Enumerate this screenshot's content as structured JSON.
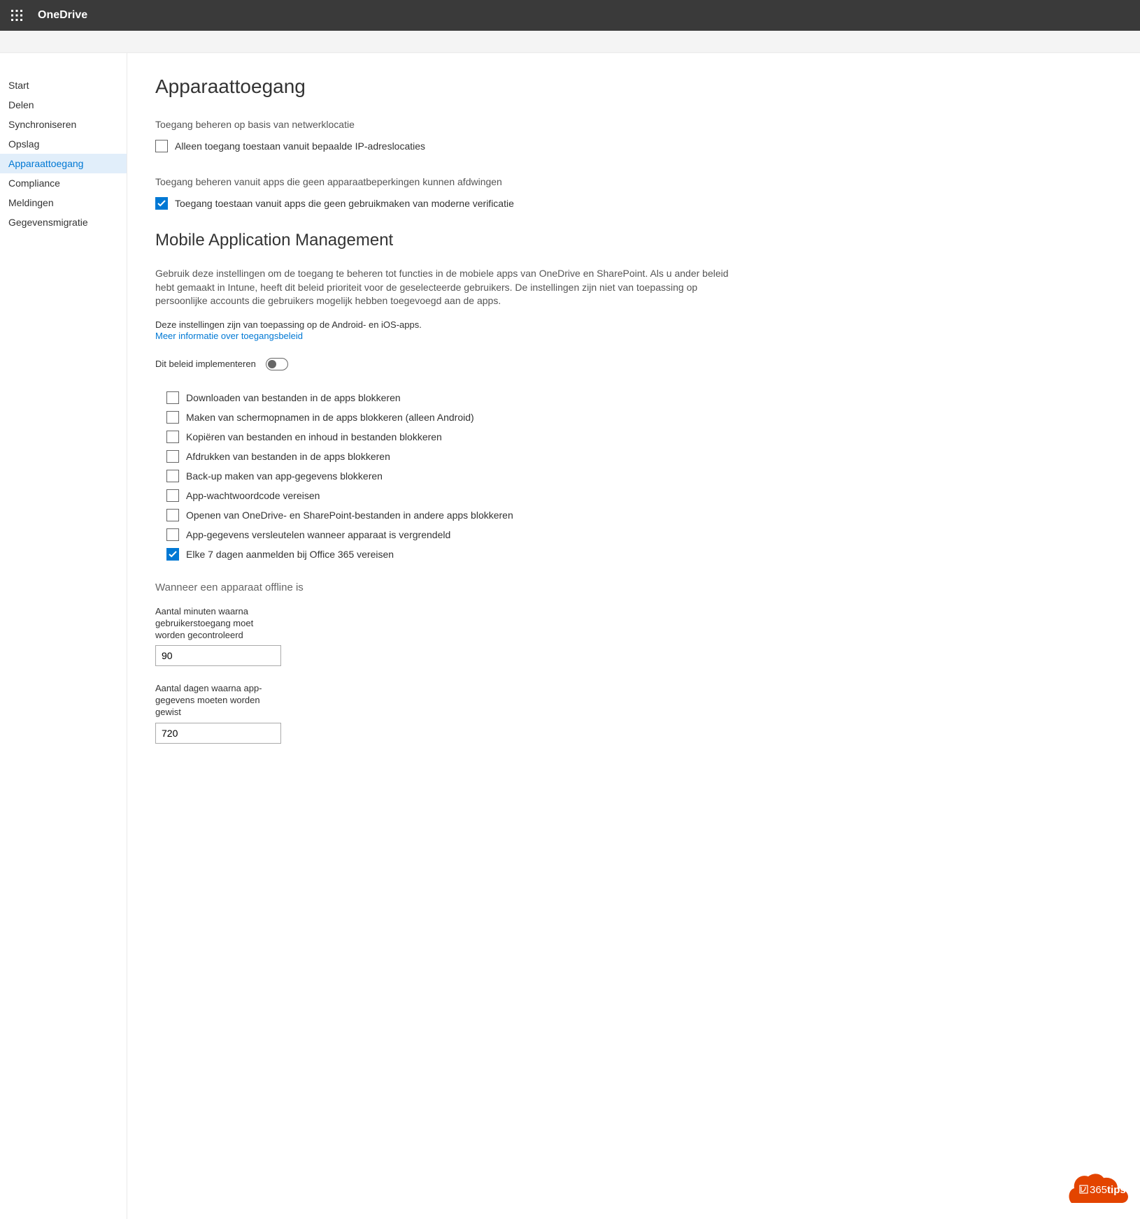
{
  "header": {
    "app_title": "OneDrive"
  },
  "sidebar": {
    "items": [
      {
        "label": "Start"
      },
      {
        "label": "Delen"
      },
      {
        "label": "Synchroniseren"
      },
      {
        "label": "Opslag"
      },
      {
        "label": "Apparaattoegang"
      },
      {
        "label": "Compliance"
      },
      {
        "label": "Meldingen"
      },
      {
        "label": "Gegevensmigratie"
      }
    ],
    "active_index": 4
  },
  "main": {
    "h1": "Apparaattoegang",
    "section1_sub": "Toegang beheren op basis van netwerklocatie",
    "cb_ip_label": "Alleen toegang toestaan vanuit bepaalde IP-adreslocaties",
    "section2_sub": "Toegang beheren vanuit apps die geen apparaatbeperkingen kunnen afdwingen",
    "cb_modern_auth_label": "Toegang toestaan vanuit apps die geen gebruikmaken van moderne verificatie",
    "h2": "Mobile Application Management",
    "mam_body": "Gebruik deze instellingen om de toegang te beheren tot functies in de mobiele apps van OneDrive en SharePoint. Als u ander beleid hebt gemaakt in Intune, heeft dit beleid prioriteit voor de geselecteerde gebruikers. De instellingen zijn niet van toepassing op persoonlijke accounts die gebruikers mogelijk hebben toegevoegd aan de apps.",
    "mam_note": "Deze instellingen zijn van toepassing op de Android- en iOS-apps.",
    "mam_link": "Meer informatie over toegangsbeleid",
    "toggle_label": "Dit beleid implementeren",
    "options": [
      {
        "label": "Downloaden van bestanden in de apps blokkeren",
        "checked": false
      },
      {
        "label": "Maken van schermopnamen in de apps blokkeren (alleen Android)",
        "checked": false
      },
      {
        "label": "Kopiëren van bestanden en inhoud in bestanden blokkeren",
        "checked": false
      },
      {
        "label": "Afdrukken van bestanden in de apps blokkeren",
        "checked": false
      },
      {
        "label": "Back-up maken van app-gegevens blokkeren",
        "checked": false
      },
      {
        "label": "App-wachtwoordcode vereisen",
        "checked": false
      },
      {
        "label": "Openen van OneDrive- en SharePoint-bestanden in andere apps blokkeren",
        "checked": false
      },
      {
        "label": "App-gegevens versleutelen wanneer apparaat is vergrendeld",
        "checked": false
      },
      {
        "label": "Elke 7 dagen aanmelden bij Office 365 vereisen",
        "checked": true
      }
    ],
    "offline_heading": "Wanneer een apparaat offline is",
    "field1_label": "Aantal minuten waarna gebruikerstoegang moet worden gecontroleerd",
    "field1_value": "90",
    "field2_label": "Aantal dagen waarna app-gegevens moeten worden gewist",
    "field2_value": "720"
  },
  "badge": {
    "text_num": "365",
    "text_word": "tips"
  }
}
